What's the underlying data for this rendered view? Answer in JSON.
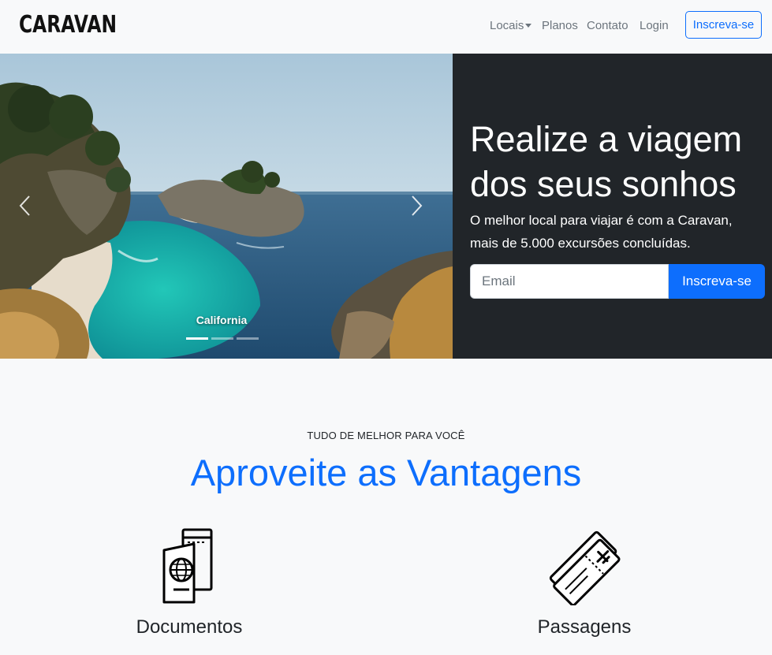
{
  "navbar": {
    "brand": "CARAVAN",
    "items": [
      {
        "label": "Locais"
      },
      {
        "label": "Planos"
      },
      {
        "label": "Contato"
      },
      {
        "label": "Login"
      }
    ],
    "cta_label": "Inscreva-se"
  },
  "carousel": {
    "caption": "California",
    "slide_count": 3,
    "active_index": 0
  },
  "hero": {
    "title": "Realize a viagem dos seus sonhos",
    "subtitle": "O melhor local para viajar é com a Caravan, mais de 5.000 excursões concluídas.",
    "email_placeholder": "Email",
    "button_label": "Inscreva-se"
  },
  "features": {
    "eyebrow": "TUDO DE MELHOR PARA VOCÊ",
    "title": "Aproveite as Vantagens",
    "items": [
      {
        "icon": "passport-icon",
        "title": "Documentos"
      },
      {
        "icon": "ticket-icon",
        "title": "Passagens"
      }
    ]
  },
  "colors": {
    "primary": "#0d6efd",
    "dark_panel": "#212529",
    "background": "#f8f9fa"
  }
}
